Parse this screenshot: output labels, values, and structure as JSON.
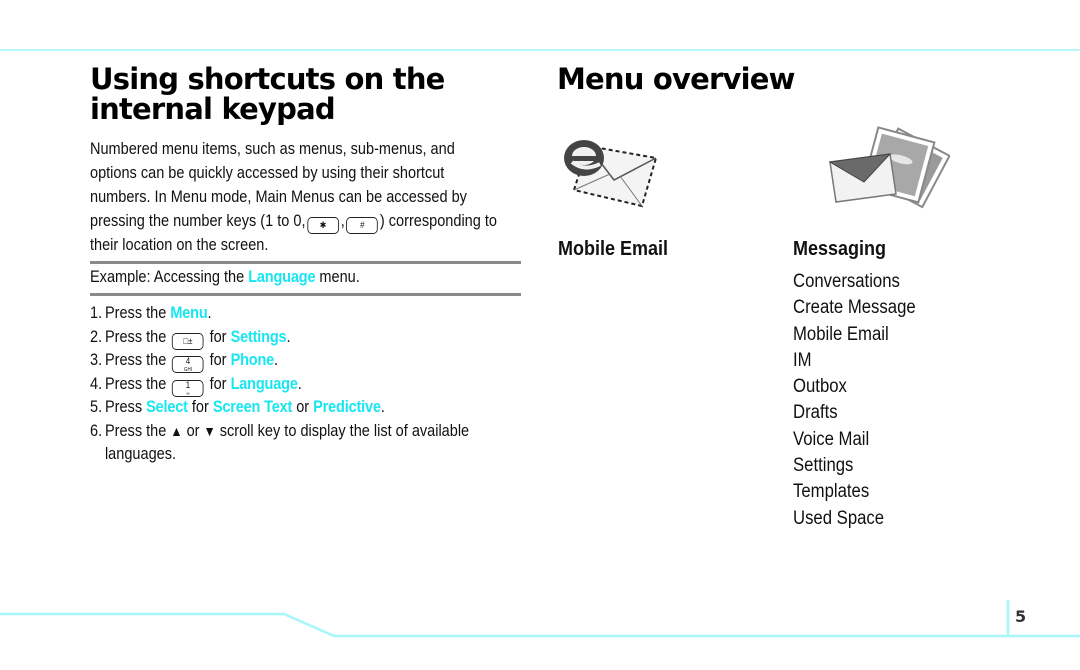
{
  "left_section": {
    "title": "Using shortcuts on the internal keypad",
    "intro_lines": [
      "Numbered menu items, such as menus, sub-menus, and",
      "options can be quickly accessed by using their shortcut",
      "numbers. In Menu mode, Main Menus can be accessed by",
      {
        "before": "pressing the number keys (1 to 0,",
        "key1": "✱",
        "mid": ",",
        "key2": "#",
        "after": ") corresponding to"
      },
      "their location on the screen."
    ],
    "example": {
      "before": "Example: Accessing the ",
      "highlight": "Language",
      "after": " menu."
    },
    "steps": [
      {
        "num": "1.",
        "before": "Press the ",
        "highlight": "Menu",
        "after": "."
      },
      {
        "num": "2.",
        "before": "Press the ",
        "key": "□±",
        "mid": " for ",
        "highlight": "Settings",
        "after": "."
      },
      {
        "num": "3.",
        "before": "Press the ",
        "key": "4",
        "key_sub": "GHI",
        "mid": " for ",
        "highlight": "Phone",
        "after": "."
      },
      {
        "num": "4.",
        "before": "Press the ",
        "key": "1",
        "key_sub": "∞",
        "mid": " for ",
        "highlight": "Language",
        "after": "."
      },
      {
        "num": "5.",
        "before": "Press ",
        "h1": "Select",
        "m1": " for ",
        "h2": "Screen Text",
        "m2": " or ",
        "h3": "Predictive",
        "after": "."
      },
      {
        "num": "6.",
        "before": "Press the ",
        "up": "▲",
        "m1": " or ",
        "down": "▼",
        "line1_after": " scroll key to display the list of available",
        "line2": "languages."
      }
    ]
  },
  "right_section": {
    "title": "Menu overview",
    "categories": [
      {
        "title": "Mobile Email",
        "icon": "mobile-email-icon",
        "items": []
      },
      {
        "title": "Messaging",
        "icon": "messaging-icon",
        "items": [
          "Conversations",
          "Create Message",
          "Mobile Email",
          "IM",
          "Outbox",
          "Drafts",
          "Voice Mail",
          "Settings",
          "Templates",
          "Used Space"
        ]
      }
    ]
  },
  "footer": {
    "page_number": "5"
  },
  "colors": {
    "accent": "#18e6f0",
    "rule": "#b8f7fa"
  }
}
